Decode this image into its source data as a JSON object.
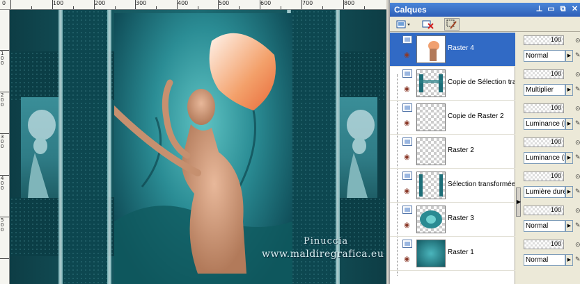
{
  "rulers": {
    "top_ticks": [
      "0",
      "100",
      "200",
      "300",
      "400",
      "500",
      "600",
      "700",
      "800"
    ],
    "left_ticks": [
      "100",
      "200",
      "300",
      "400",
      "500"
    ]
  },
  "canvas": {
    "watermark_line1": "Pinuccia",
    "watermark_line2": "www.maldiregrafica.eu"
  },
  "layers_panel": {
    "title": "Calques",
    "controls": {
      "pin": "⊥",
      "minimize": "▭",
      "restore": "⧉",
      "close": "✕"
    },
    "toolbar": {
      "new_layer_icon": "new-layer-icon",
      "delete_layer_icon": "delete-layer-icon",
      "edit_icon": "edit-wand-icon"
    },
    "layers": [
      {
        "name": "Raster 4",
        "opacity": "100",
        "blend": "Normal",
        "selected": true
      },
      {
        "name": "Copie de Sélection tran",
        "opacity": "100",
        "blend": "Multiplier",
        "selected": false
      },
      {
        "name": "Copie de Raster 2",
        "opacity": "100",
        "blend": "Luminance (H)",
        "selected": false
      },
      {
        "name": "Raster 2",
        "opacity": "100",
        "blend": "Luminance (H)",
        "selected": false
      },
      {
        "name": "Sélection transformée",
        "opacity": "100",
        "blend": "Lumière dure",
        "selected": false
      },
      {
        "name": "Raster 3",
        "opacity": "100",
        "blend": "Normal",
        "selected": false
      },
      {
        "name": "Raster 1",
        "opacity": "100",
        "blend": "Normal",
        "selected": false
      }
    ]
  }
}
